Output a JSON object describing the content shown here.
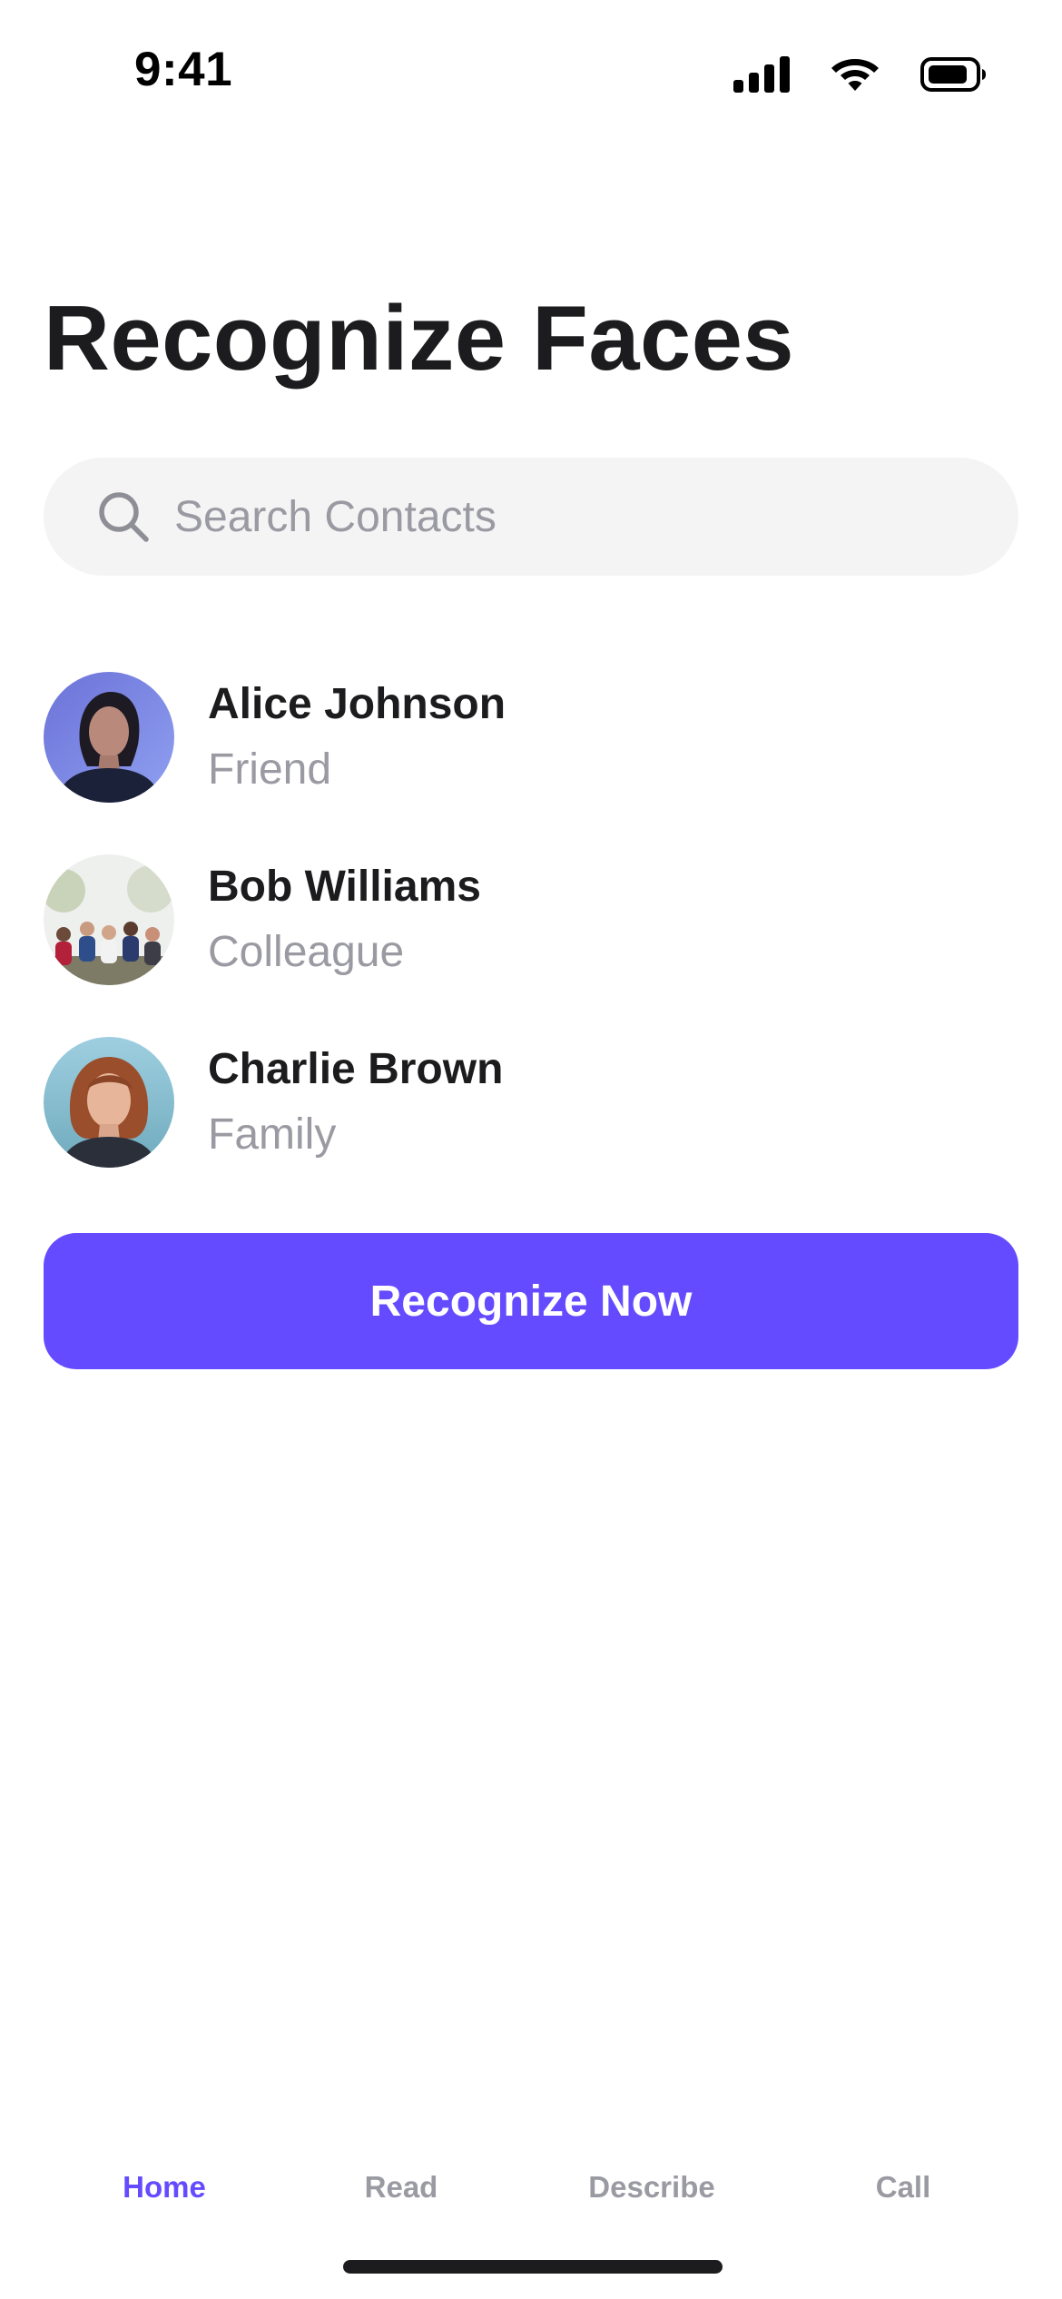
{
  "status_bar": {
    "time": "9:41",
    "icons": [
      "cellular-signal-icon",
      "wifi-icon",
      "battery-icon"
    ]
  },
  "header": {
    "title": "Recognize Faces"
  },
  "search": {
    "placeholder": "Search Contacts",
    "value": "",
    "icon": "search-icon"
  },
  "contacts": [
    {
      "name": "Alice Johnson",
      "relation": "Friend",
      "avatar": "woman-portrait-blue-light"
    },
    {
      "name": "Bob Williams",
      "relation": "Colleague",
      "avatar": "group-photo-outdoors"
    },
    {
      "name": "Charlie Brown",
      "relation": "Family",
      "avatar": "red-haired-girl-portrait"
    }
  ],
  "primary_action": {
    "label": "Recognize Now"
  },
  "tab_bar": {
    "active": "Home",
    "tabs": [
      {
        "label": "Home"
      },
      {
        "label": "Read"
      },
      {
        "label": "Describe"
      },
      {
        "label": "Call"
      }
    ]
  },
  "colors": {
    "accent": "#644BFF",
    "text_primary": "#1C1C1E",
    "text_secondary": "#9A9AA2",
    "search_background": "#F4F4F5",
    "background": "#FFFFFF"
  }
}
